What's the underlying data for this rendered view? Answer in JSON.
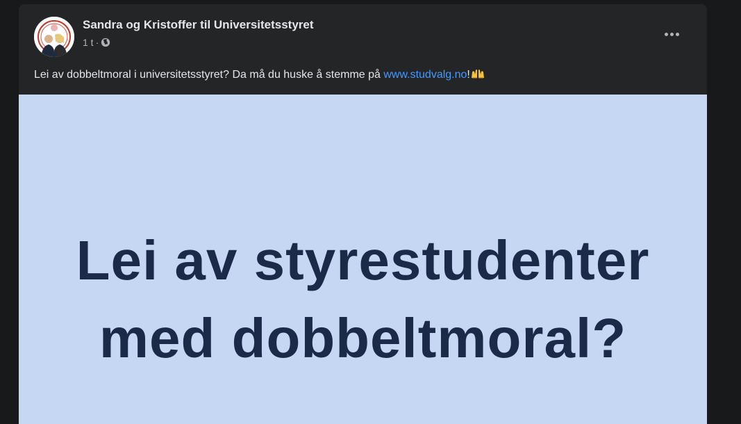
{
  "post": {
    "author": "Sandra og Kristoffer til Universitetsstyret",
    "time": "1 t",
    "separator": "·",
    "visibility_icon": "globe-icon",
    "more_icon": "more-options-icon",
    "text_prefix": "Lei av dobbeltmoral i universitetsstyret? Da må du huske å stemme på ",
    "link_text": "www.studvalg.no",
    "text_suffix": "!",
    "emoji": "raising-hands-emoji"
  },
  "image": {
    "headline_line1": "Lei av styrestudenter",
    "headline_line2": "med dobbeltmoral?",
    "background_color": "#c5d7f2",
    "text_color": "#1b2a48"
  },
  "colors": {
    "page_background": "#18191a",
    "card_background": "#242526",
    "primary_text": "#e4e6eb",
    "secondary_text": "#b0b3b8",
    "link": "#4599ff"
  }
}
